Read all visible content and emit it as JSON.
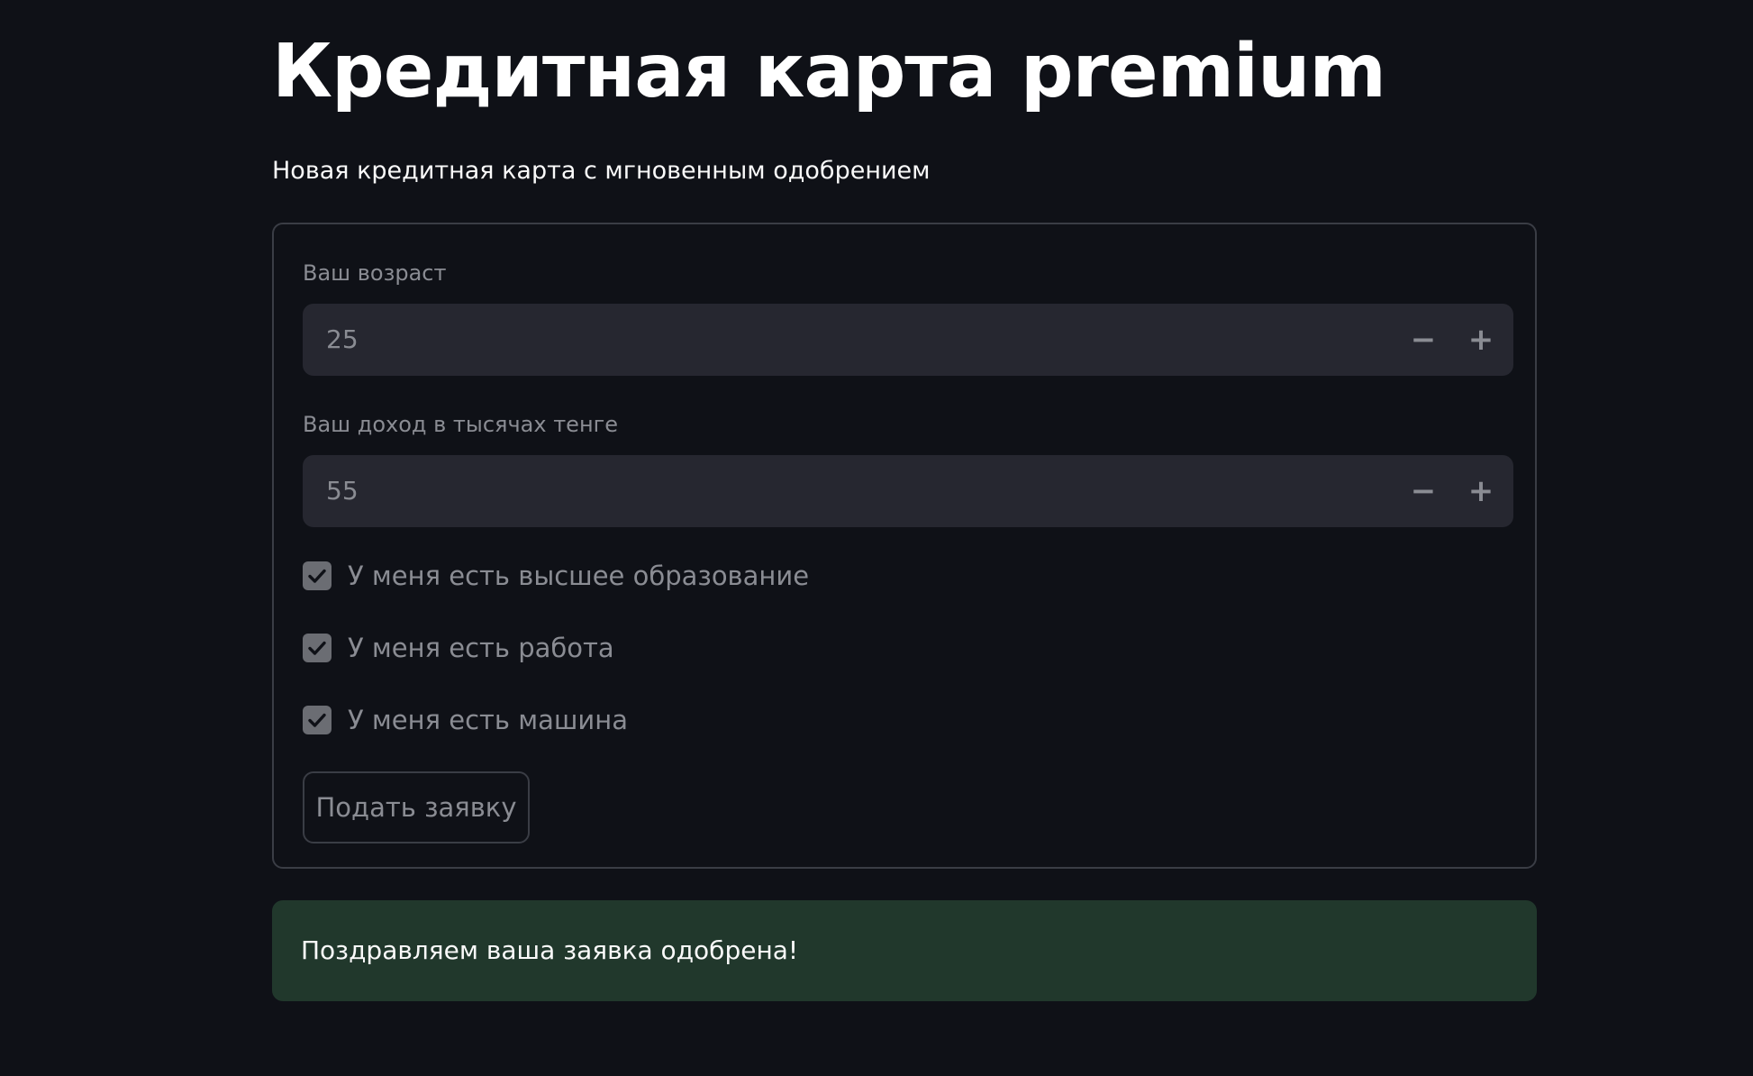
{
  "page": {
    "title": "Кредитная карта premium",
    "subtitle": "Новая кредитная карта с мгновенным одобрением"
  },
  "form": {
    "age": {
      "label": "Ваш возраст",
      "value": "25",
      "decrement_label": "−",
      "increment_label": "+"
    },
    "income": {
      "label": "Ваш доход в тысячах тенге",
      "value": "55",
      "decrement_label": "−",
      "increment_label": "+"
    },
    "checkboxes": [
      {
        "label": "У меня есть высшее образование",
        "checked": true
      },
      {
        "label": "У меня есть работа",
        "checked": true
      },
      {
        "label": "У меня есть машина",
        "checked": true
      }
    ],
    "submit_label": "Подать заявку"
  },
  "alert": {
    "message": "Поздравляем ваша заявка одобрена!"
  },
  "colors": {
    "background": "#0f1117",
    "input_background": "#262730",
    "border": "#3a3d45",
    "muted_text": "#8a8c93",
    "success_background": "#21382c",
    "checkbox_fill": "#6b6d73"
  },
  "icons": {
    "checkbox": "check-icon",
    "decrement": "minus-icon",
    "increment": "plus-icon"
  }
}
